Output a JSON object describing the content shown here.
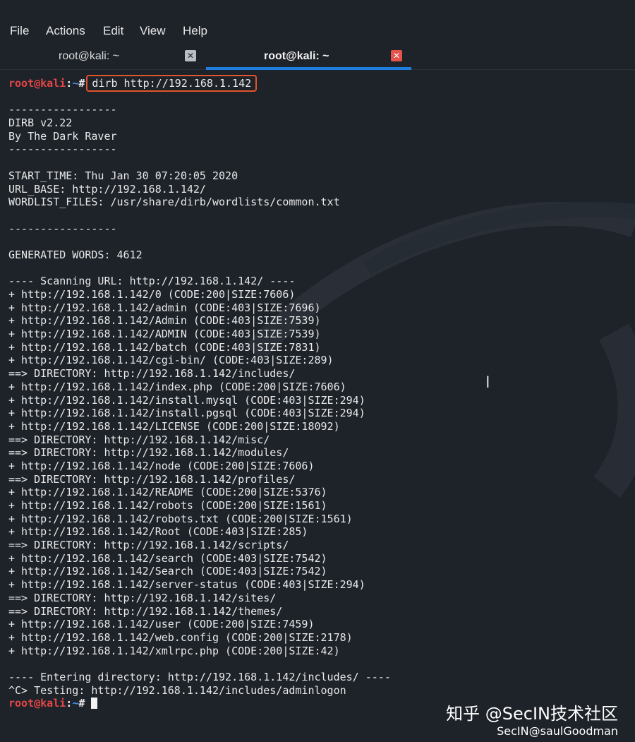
{
  "menu": [
    "File",
    "Actions",
    "Edit",
    "View",
    "Help"
  ],
  "tabs": [
    {
      "label": "root@kali: ~",
      "active": false
    },
    {
      "label": "root@kali: ~",
      "active": true
    }
  ],
  "prompt": {
    "user": "root@kali",
    "path": "~",
    "symbol": "#"
  },
  "command": "dirb http://192.168.1.142",
  "output": [
    "",
    "-----------------",
    "DIRB v2.22",
    "By The Dark Raver",
    "-----------------",
    "",
    "START_TIME: Thu Jan 30 07:20:05 2020",
    "URL_BASE: http://192.168.1.142/",
    "WORDLIST_FILES: /usr/share/dirb/wordlists/common.txt",
    "",
    "-----------------",
    "",
    "GENERATED WORDS: 4612",
    "",
    "---- Scanning URL: http://192.168.1.142/ ----",
    "+ http://192.168.1.142/0 (CODE:200|SIZE:7606)",
    "+ http://192.168.1.142/admin (CODE:403|SIZE:7696)",
    "+ http://192.168.1.142/Admin (CODE:403|SIZE:7539)",
    "+ http://192.168.1.142/ADMIN (CODE:403|SIZE:7539)",
    "+ http://192.168.1.142/batch (CODE:403|SIZE:7831)",
    "+ http://192.168.1.142/cgi-bin/ (CODE:403|SIZE:289)",
    "==> DIRECTORY: http://192.168.1.142/includes/",
    "+ http://192.168.1.142/index.php (CODE:200|SIZE:7606)",
    "+ http://192.168.1.142/install.mysql (CODE:403|SIZE:294)",
    "+ http://192.168.1.142/install.pgsql (CODE:403|SIZE:294)",
    "+ http://192.168.1.142/LICENSE (CODE:200|SIZE:18092)",
    "==> DIRECTORY: http://192.168.1.142/misc/",
    "==> DIRECTORY: http://192.168.1.142/modules/",
    "+ http://192.168.1.142/node (CODE:200|SIZE:7606)",
    "==> DIRECTORY: http://192.168.1.142/profiles/",
    "+ http://192.168.1.142/README (CODE:200|SIZE:5376)",
    "+ http://192.168.1.142/robots (CODE:200|SIZE:1561)",
    "+ http://192.168.1.142/robots.txt (CODE:200|SIZE:1561)",
    "+ http://192.168.1.142/Root (CODE:403|SIZE:285)",
    "==> DIRECTORY: http://192.168.1.142/scripts/",
    "+ http://192.168.1.142/search (CODE:403|SIZE:7542)",
    "+ http://192.168.1.142/Search (CODE:403|SIZE:7542)",
    "+ http://192.168.1.142/server-status (CODE:403|SIZE:294)",
    "==> DIRECTORY: http://192.168.1.142/sites/",
    "==> DIRECTORY: http://192.168.1.142/themes/",
    "+ http://192.168.1.142/user (CODE:200|SIZE:7459)",
    "+ http://192.168.1.142/web.config (CODE:200|SIZE:2178)",
    "+ http://192.168.1.142/xmlrpc.php (CODE:200|SIZE:42)",
    "",
    "---- Entering directory: http://192.168.1.142/includes/ ----",
    "^C> Testing: http://192.168.1.142/includes/adminlogon"
  ],
  "watermark": {
    "main": "知乎 @SecIN技术社区",
    "sub": "SecIN@saulGoodman"
  },
  "colors": {
    "background": "#1e232a",
    "prompt_user": "#e34646",
    "prompt_path": "#4e8ef0",
    "command_highlight": "#e0552b",
    "active_tab": "#1f7fe0",
    "close_active": "#e5534b"
  }
}
